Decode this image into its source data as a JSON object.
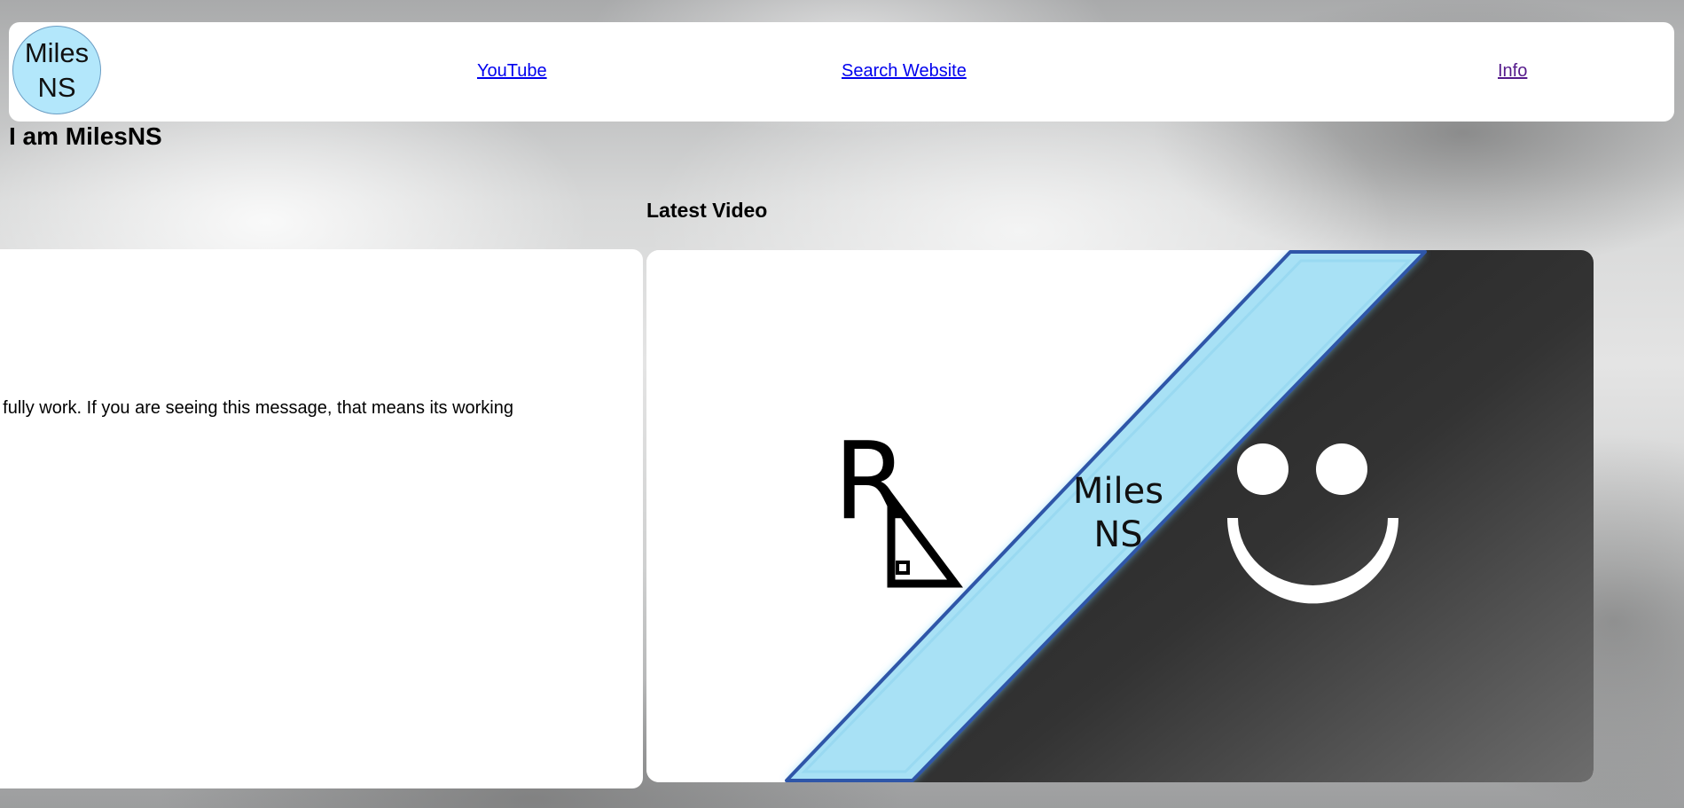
{
  "navbar": {
    "logo_line1": "Miles",
    "logo_line2": "NS",
    "links": {
      "youtube": "YouTube",
      "search": "Search Website",
      "info": "Info"
    }
  },
  "main": {
    "greeting": "I am MilesNS",
    "intro_text": "This site is still a work in progress, so some things may not fully work. If you are seeing this message, that means its working",
    "latest_video": {
      "heading": "Latest Video",
      "thumbnail": {
        "logo_text_line1": "Miles",
        "logo_text_line2": "NS",
        "left_mark": "R"
      }
    }
  },
  "colors": {
    "logo_fill": "#b3e7fb",
    "stripe": "#a8e1f5",
    "stripe_edge": "#2f56a8",
    "dark_panel": "#2b2b2b",
    "link": "#0000ee",
    "link_visited": "#551a8b"
  }
}
